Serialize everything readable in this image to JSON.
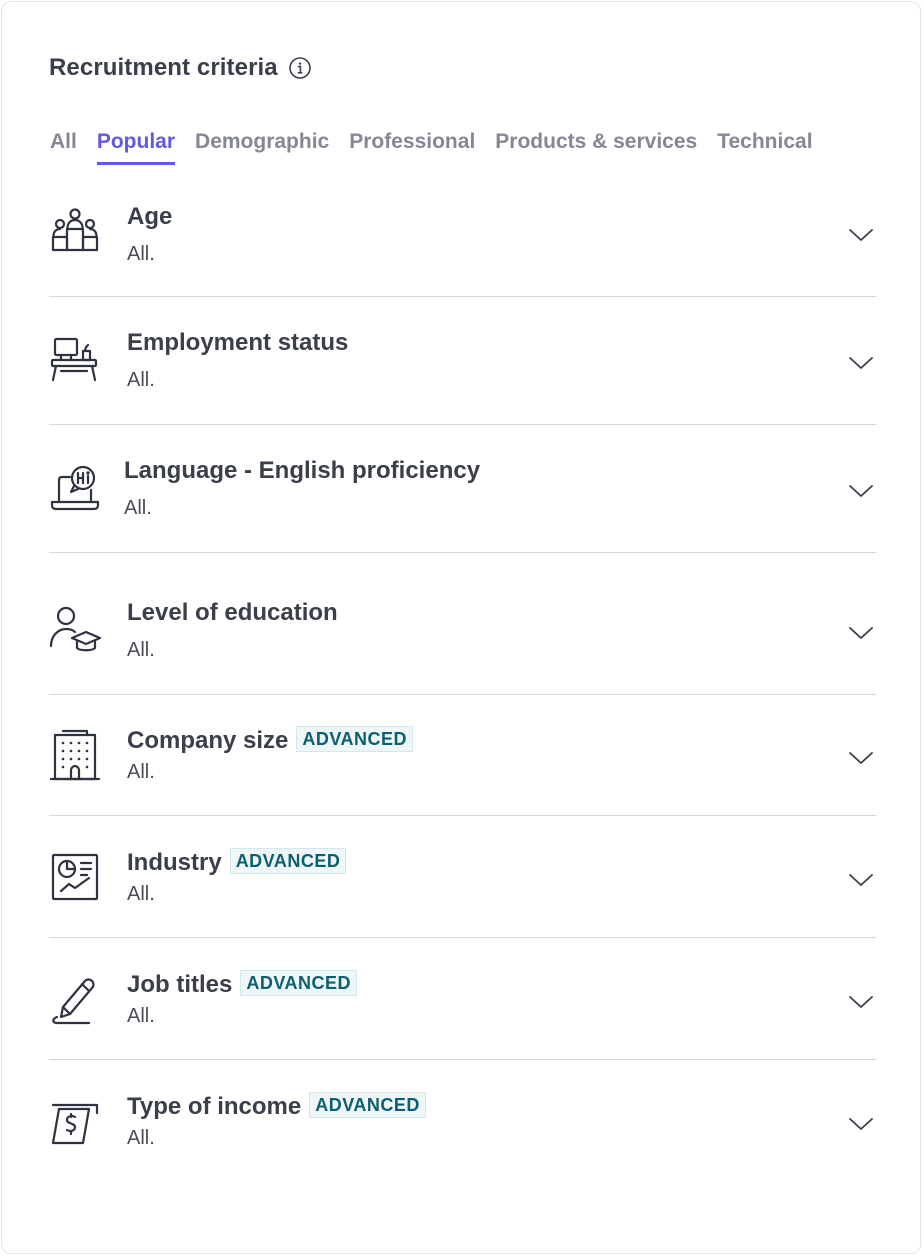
{
  "panel": {
    "title": "Recruitment criteria",
    "info_icon": "info-icon"
  },
  "tabs": [
    {
      "label": "All",
      "active": false
    },
    {
      "label": "Popular",
      "active": true
    },
    {
      "label": "Demographic",
      "active": false
    },
    {
      "label": "Professional",
      "active": false
    },
    {
      "label": "Products & services",
      "active": false
    },
    {
      "label": "Technical",
      "active": false
    }
  ],
  "criteria": [
    {
      "title": "Age",
      "value": "All.",
      "icon": "people-podium-icon",
      "badge": ""
    },
    {
      "title": "Employment status",
      "value": "All.",
      "icon": "desk-computer-icon",
      "badge": ""
    },
    {
      "title": "Language - English proficiency",
      "value": "All.",
      "icon": "laptop-chat-hi-icon",
      "badge": ""
    },
    {
      "title": "Level of education",
      "value": "All.",
      "icon": "graduate-person-icon",
      "badge": ""
    },
    {
      "title": "Company size",
      "value": "All.",
      "icon": "building-icon",
      "badge": "ADVANCED"
    },
    {
      "title": "Industry",
      "value": "All.",
      "icon": "industry-chart-icon",
      "badge": "ADVANCED"
    },
    {
      "title": "Job titles",
      "value": "All.",
      "icon": "pen-signature-icon",
      "badge": "ADVANCED"
    },
    {
      "title": "Type of income",
      "value": "All.",
      "icon": "dollar-bill-icon",
      "badge": "ADVANCED"
    }
  ],
  "colors": {
    "accent": "#6259e0",
    "badge_text": "#0b5f70",
    "badge_bg": "#eef6f8",
    "text": "#3b3e4b",
    "muted_tab": "#858795"
  }
}
